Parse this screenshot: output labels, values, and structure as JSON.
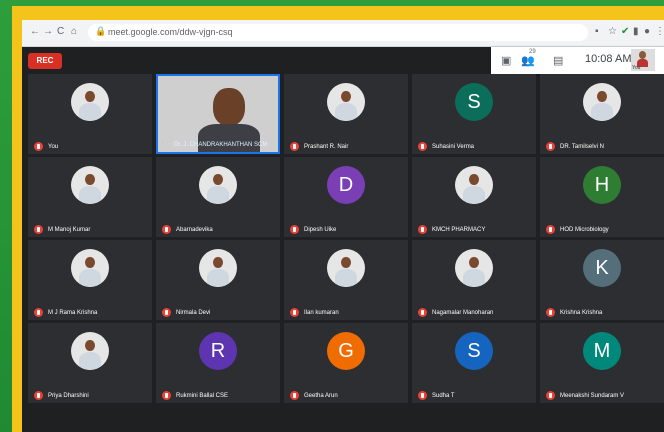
{
  "browser": {
    "url": "meet.google.com/ddw-vjgn-csq",
    "nav_back": "←",
    "nav_forward": "→",
    "nav_reload": "C",
    "nav_home": "⌂"
  },
  "meeting": {
    "rec_label": "REC",
    "clock": "10:08 AM",
    "participant_count": "29",
    "self_label": "You"
  },
  "colors": {
    "outer_green": "#2a9a3a",
    "frame_yellow": "#f4c41a",
    "grid_bg": "#202124",
    "tile_bg": "#2d2e31",
    "mute_red": "#ea4335",
    "active_blue": "#1a73e8"
  },
  "tiles": [
    {
      "name": "You",
      "type": "photo"
    },
    {
      "name": "Dr. J. CHANDRAKHANTHAN SCM",
      "type": "video"
    },
    {
      "name": "Prashant R. Nair",
      "type": "photo"
    },
    {
      "name": "Suhasini Verma",
      "type": "letter",
      "letter": "S",
      "color": "#0b6e5a"
    },
    {
      "name": "DR. Tamilselvi N",
      "type": "photo"
    },
    {
      "name": "M Manoj Kumar",
      "type": "photo"
    },
    {
      "name": "Abarnadevika",
      "type": "photo"
    },
    {
      "name": "Dipesh Uike",
      "type": "letter",
      "letter": "D",
      "color": "#7b3fb5"
    },
    {
      "name": "KMCH PHARMACY",
      "type": "photo"
    },
    {
      "name": "HOD Microbiology",
      "type": "letter",
      "letter": "H",
      "color": "#2e7d32"
    },
    {
      "name": "M J Rama Krishna",
      "type": "photo"
    },
    {
      "name": "Nirmala Devi",
      "type": "photo"
    },
    {
      "name": "Ilan kumaran",
      "type": "photo"
    },
    {
      "name": "Nagamalar Manoharan",
      "type": "photo"
    },
    {
      "name": "Krishna Krishna",
      "type": "letter",
      "letter": "K",
      "color": "#546e7a"
    },
    {
      "name": "Priya Dharshini",
      "type": "photo"
    },
    {
      "name": "Rukmini Ballal CSE",
      "type": "letter",
      "letter": "R",
      "color": "#5e35b1"
    },
    {
      "name": "Geetha Arun",
      "type": "letter",
      "letter": "G",
      "color": "#ef6c00"
    },
    {
      "name": "Sudha T",
      "type": "letter",
      "letter": "S",
      "color": "#1565c0"
    },
    {
      "name": "Meenakshi Sundaram V",
      "type": "letter",
      "letter": "M",
      "color": "#00897b"
    }
  ]
}
